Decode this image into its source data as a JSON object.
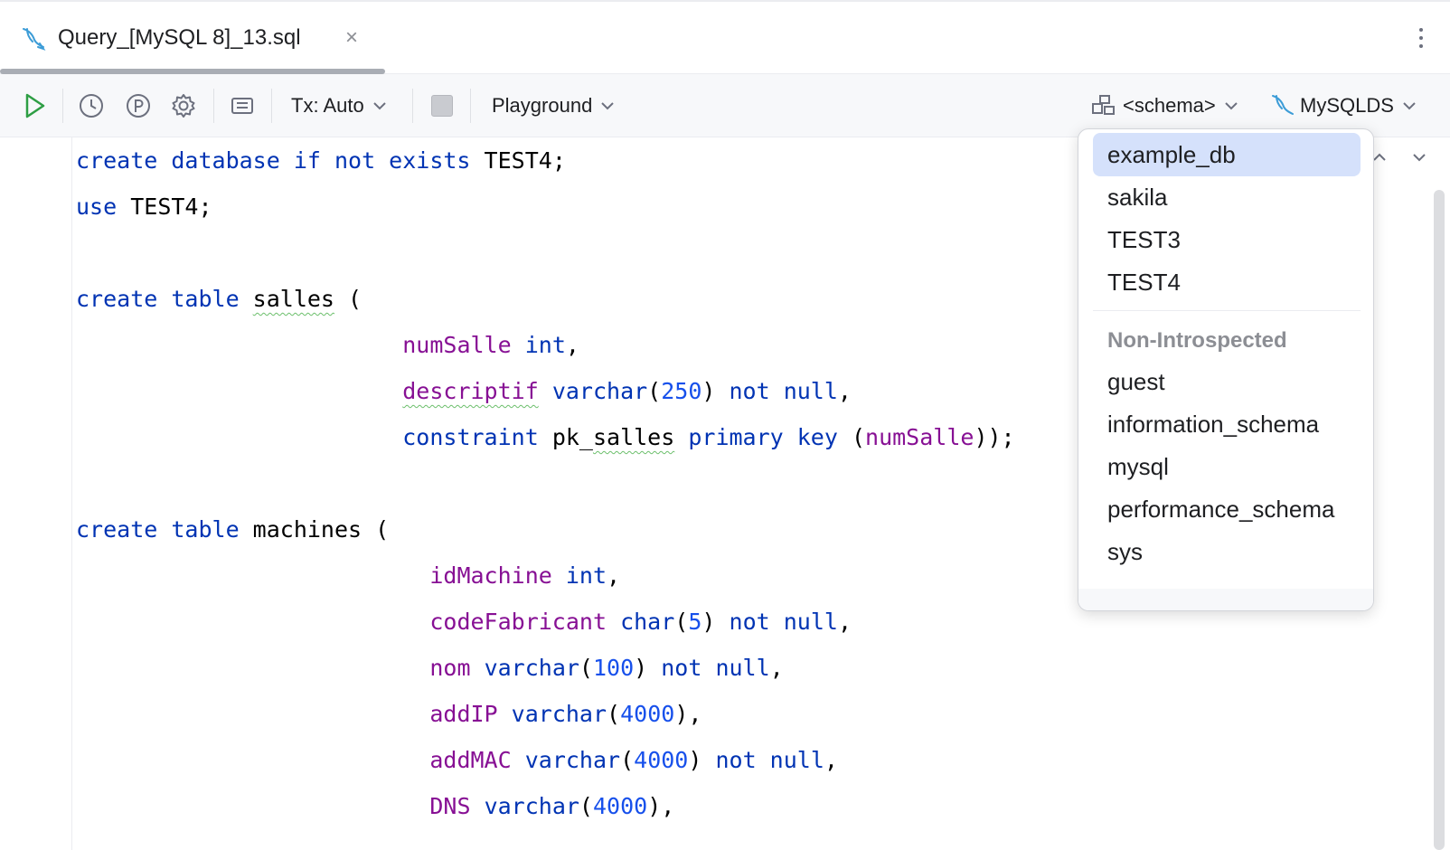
{
  "tab": {
    "title": "Query_[MySQL 8]_13.sql",
    "close_glyph": "×",
    "icon": "mysql-dolphin-icon"
  },
  "toolbar": {
    "run_icon": "play-icon",
    "history_icon": "clock-icon",
    "params_icon": "p-circle-icon",
    "settings_icon": "gear-icon",
    "layout_icon": "panel-icon",
    "tx_label": "Tx: Auto",
    "stop_icon": "stop-icon",
    "playground_label": "Playground",
    "schema_label": "<schema>",
    "datasource_label": "MySQLDS"
  },
  "editor": {
    "lines": [
      [
        [
          "kw",
          "create database if not exists "
        ],
        [
          "id",
          "TEST4"
        ],
        [
          "p",
          ";"
        ]
      ],
      [
        [
          "kw",
          "use "
        ],
        [
          "id",
          "TEST4"
        ],
        [
          "p",
          ";"
        ]
      ],
      [],
      [
        [
          "kw",
          "create table "
        ],
        [
          "idw",
          "salles"
        ],
        [
          "p",
          " ("
        ]
      ],
      [
        [
          "pad",
          "                        "
        ],
        [
          "col",
          "numSalle"
        ],
        [
          "p",
          " "
        ],
        [
          "kw",
          "int"
        ],
        [
          "p",
          ","
        ]
      ],
      [
        [
          "pad",
          "                        "
        ],
        [
          "colw",
          "descriptif"
        ],
        [
          "p",
          " "
        ],
        [
          "kw",
          "varchar"
        ],
        [
          "p",
          "("
        ],
        [
          "num",
          "250"
        ],
        [
          "p",
          ") "
        ],
        [
          "kw",
          "not null"
        ],
        [
          "p",
          ","
        ]
      ],
      [
        [
          "pad",
          "                        "
        ],
        [
          "kw",
          "constraint "
        ],
        [
          "id",
          "pk_"
        ],
        [
          "idw",
          "salles"
        ],
        [
          "p",
          " "
        ],
        [
          "kw",
          "primary key"
        ],
        [
          "p",
          " ("
        ],
        [
          "col",
          "numSalle"
        ],
        [
          "p",
          "));"
        ]
      ],
      [],
      [
        [
          "kw",
          "create table "
        ],
        [
          "id",
          "machines"
        ],
        [
          "p",
          " ("
        ]
      ],
      [
        [
          "pad",
          "                          "
        ],
        [
          "col",
          "idMachine"
        ],
        [
          "p",
          " "
        ],
        [
          "kw",
          "int"
        ],
        [
          "p",
          ","
        ]
      ],
      [
        [
          "pad",
          "                          "
        ],
        [
          "col",
          "codeFabricant"
        ],
        [
          "p",
          " "
        ],
        [
          "kw",
          "char"
        ],
        [
          "p",
          "("
        ],
        [
          "num",
          "5"
        ],
        [
          "p",
          ") "
        ],
        [
          "kw",
          "not null"
        ],
        [
          "p",
          ","
        ]
      ],
      [
        [
          "pad",
          "                          "
        ],
        [
          "col",
          "nom"
        ],
        [
          "p",
          " "
        ],
        [
          "kw",
          "varchar"
        ],
        [
          "p",
          "("
        ],
        [
          "num",
          "100"
        ],
        [
          "p",
          ") "
        ],
        [
          "kw",
          "not null"
        ],
        [
          "p",
          ","
        ]
      ],
      [
        [
          "pad",
          "                          "
        ],
        [
          "col",
          "addIP"
        ],
        [
          "p",
          " "
        ],
        [
          "kw",
          "varchar"
        ],
        [
          "p",
          "("
        ],
        [
          "num",
          "4000"
        ],
        [
          "p",
          "),"
        ]
      ],
      [
        [
          "pad",
          "                          "
        ],
        [
          "col",
          "addMAC"
        ],
        [
          "p",
          " "
        ],
        [
          "kw",
          "varchar"
        ],
        [
          "p",
          "("
        ],
        [
          "num",
          "4000"
        ],
        [
          "p",
          ") "
        ],
        [
          "kw",
          "not null"
        ],
        [
          "p",
          ","
        ]
      ],
      [
        [
          "pad",
          "                          "
        ],
        [
          "col",
          "DNS"
        ],
        [
          "p",
          " "
        ],
        [
          "kw",
          "varchar"
        ],
        [
          "p",
          "("
        ],
        [
          "num",
          "4000"
        ],
        [
          "p",
          "),"
        ]
      ]
    ]
  },
  "schema_popup": {
    "introspected": [
      "example_db",
      "sakila",
      "TEST3",
      "TEST4"
    ],
    "selected": "example_db",
    "non_introspected_header": "Non-Introspected",
    "non_introspected": [
      "guest",
      "information_schema",
      "mysql",
      "performance_schema",
      "sys"
    ]
  },
  "colors": {
    "keyword": "#0033b3",
    "column": "#871094",
    "number": "#1750eb",
    "selection": "#d5e1fb",
    "run": "#2e9e44"
  }
}
